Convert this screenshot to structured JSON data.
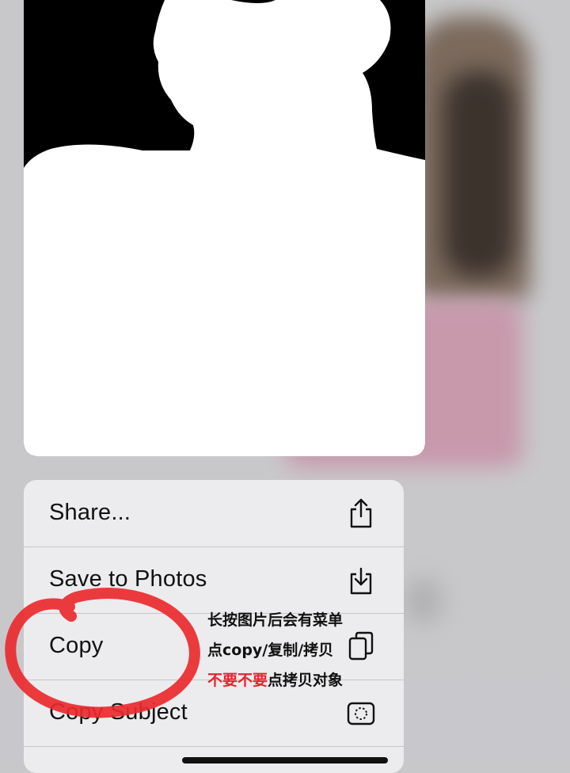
{
  "menu": {
    "items": [
      {
        "label": "Share...",
        "icon": "share-icon"
      },
      {
        "label": "Save to Photos",
        "icon": "save-to-photos-icon"
      },
      {
        "label": "Copy",
        "icon": "copy-icon"
      },
      {
        "label": "Copy Subject",
        "icon": "copy-subject-icon"
      }
    ]
  },
  "annotation": {
    "line1": "长按图片后会有菜单",
    "line2": "点copy/复制/拷贝",
    "line3_red": "不要不要",
    "line3_rest": "点拷贝对象",
    "highlight_color": "#e8232e"
  },
  "colors": {
    "menu_bg": "#ececee",
    "preview_bg": "#000000",
    "subject_mask": "#ffffff"
  }
}
